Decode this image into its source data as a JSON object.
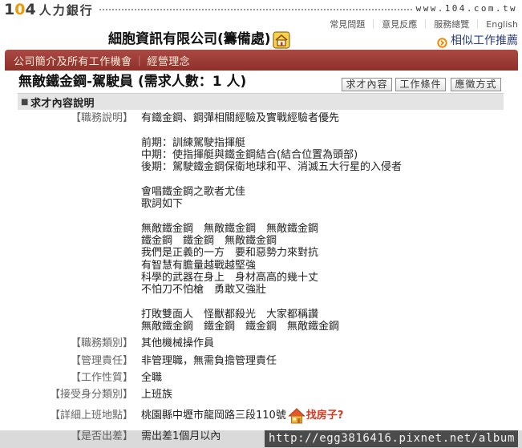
{
  "logo": {
    "digits": [
      "1",
      "0",
      "4"
    ],
    "wordmark": "人力銀行"
  },
  "site_url": "www.104.com.tw",
  "top_links": {
    "items": [
      "常見問題",
      "意見反應",
      "服務總覽",
      "English"
    ],
    "separator": "｜"
  },
  "company": {
    "name": "細胞資訊有限公司(籌備處)",
    "badge_icon": "company-badge-icon"
  },
  "similar_jobs": {
    "label": "相似工作推薦",
    "icon": "circle-arrow-icon"
  },
  "tabs": {
    "items": [
      "公司簡介及所有工作機會",
      "經營理念"
    ],
    "separator": "｜"
  },
  "job": {
    "title": "無敵鐵金鋼-駕駛員 (需求人數：1 人)",
    "section_buttons": [
      "求才內容",
      "工作條件",
      "應徵方式"
    ]
  },
  "section": {
    "bullet": "■",
    "title": "求才內容說明"
  },
  "details": [
    {
      "label": "【職務說明】",
      "paragraphs": [
        [
          "有鐵金鋼、鋼彈相關經驗及實戰經驗者優先"
        ],
        [
          "前期：訓練駕駛指揮艇",
          "中期：使指揮艇與鐵金鋼結合(結合位置為頭部)",
          "後期：駕駛鐵金鋼保衛地球和平、消滅五大行星的入侵者"
        ],
        [
          "會唱鐵金鋼之歌者尤佳",
          "歌詞如下"
        ],
        [
          "無敵鐵金鋼　無敵鐵金鋼　無敵鐵金鋼",
          "鐵金鋼　鐵金鋼　無敵鐵金鋼",
          "我們是正義的一方　要和惡勢力來對抗",
          "有智慧有膽量越戰越堅強",
          "科學的武器在身上　身材高高的幾十丈",
          "不怕刀不怕槍　勇敢又強壯"
        ],
        [
          "打敗雙面人　怪獸都殺光　大家都稱讚",
          "無敵鐵金鋼　鐵金鋼　鐵金鋼　無敵鐵金鋼"
        ]
      ]
    },
    {
      "label": "【職務類別】",
      "value": "其他機械操作員"
    },
    {
      "label": "【管理責任】",
      "value": "非管理職，無需負擔管理責任"
    },
    {
      "label": "【工作性質】",
      "value": "全職"
    },
    {
      "label": "【接受身分類別】",
      "value": "上班族"
    },
    {
      "label": "【詳細上班地點】",
      "value": "桃園縣中壢市龍岡路三段110號",
      "link": "找房子?",
      "link_icon": "house-icon"
    },
    {
      "label": "【是否出差】",
      "value": "需出差1個月以內"
    }
  ],
  "watermark": "http://egg3816416.pixnet.net/album",
  "colors": {
    "brand_orange": "#f39800",
    "tab_bar_top": "#ab4a44",
    "tab_bar": "#8f302b",
    "tab_text": "#f6ecdc",
    "similar_link": "#2b3f78",
    "section_bg": "#e4e4e4",
    "label_gray": "#666666",
    "link_red": "#d9381e"
  }
}
